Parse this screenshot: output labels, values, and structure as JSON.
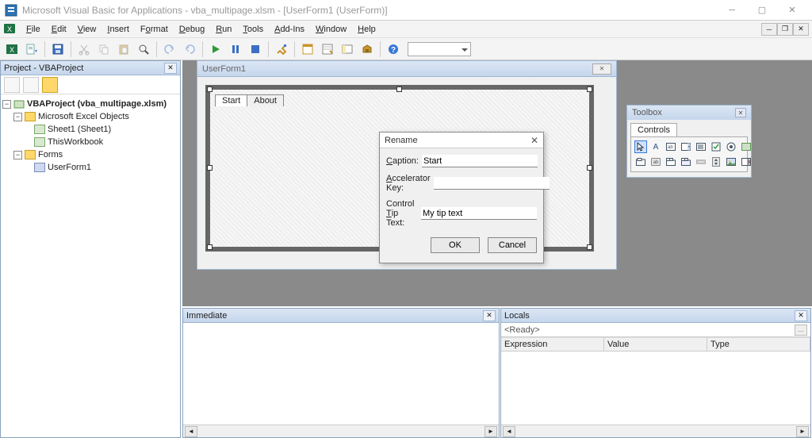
{
  "app": {
    "title": "Microsoft Visual Basic for Applications - vba_multipage.xlsm - [UserForm1 (UserForm)]"
  },
  "menu": {
    "items": [
      "File",
      "Edit",
      "View",
      "Insert",
      "Format",
      "Debug",
      "Run",
      "Tools",
      "Add-Ins",
      "Window",
      "Help"
    ]
  },
  "project": {
    "panel_title": "Project - VBAProject",
    "root": "VBAProject (vba_multipage.xlsm)",
    "group_objects": "Microsoft Excel Objects",
    "sheet1": "Sheet1 (Sheet1)",
    "thiswb": "ThisWorkbook",
    "group_forms": "Forms",
    "userform": "UserForm1"
  },
  "designer": {
    "form_caption": "UserForm1",
    "tabs": [
      "Start",
      "About"
    ]
  },
  "rename_dialog": {
    "title": "Rename",
    "caption_label": "Caption:",
    "caption_value": "Start",
    "accel_label": "Accelerator Key:",
    "accel_value": "",
    "tip_label": "Control Tip Text:",
    "tip_value": "My tip text",
    "ok": "OK",
    "cancel": "Cancel"
  },
  "toolbox": {
    "title": "Toolbox",
    "tab": "Controls"
  },
  "immediate": {
    "title": "Immediate"
  },
  "locals": {
    "title": "Locals",
    "status": "<Ready>",
    "col1": "Expression",
    "col2": "Value",
    "col3": "Type"
  }
}
